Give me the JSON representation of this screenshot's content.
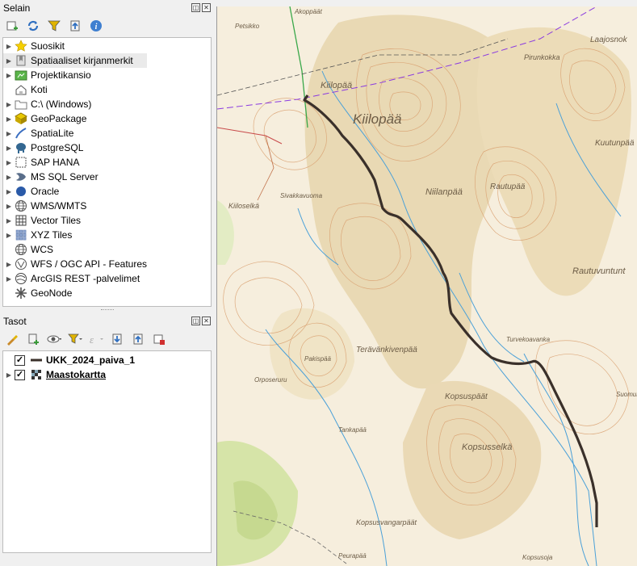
{
  "browser": {
    "title": "Selain",
    "items": [
      {
        "label": "Suosikit",
        "icon": "star-icon"
      },
      {
        "label": "Spatiaaliset kirjanmerkit",
        "icon": "bookmark-icon"
      },
      {
        "label": "Projektikansio",
        "icon": "project-folder-icon"
      },
      {
        "label": "Koti",
        "icon": "home-icon"
      },
      {
        "label": "C:\\ (Windows)",
        "icon": "drive-icon"
      },
      {
        "label": "GeoPackage",
        "icon": "geopackage-icon"
      },
      {
        "label": "SpatiaLite",
        "icon": "spatialite-icon"
      },
      {
        "label": "PostgreSQL",
        "icon": "postgresql-icon"
      },
      {
        "label": "SAP HANA",
        "icon": "hana-icon"
      },
      {
        "label": "MS SQL Server",
        "icon": "mssql-icon"
      },
      {
        "label": "Oracle",
        "icon": "oracle-icon"
      },
      {
        "label": "WMS/WMTS",
        "icon": "globe-icon"
      },
      {
        "label": "Vector Tiles",
        "icon": "vector-tiles-icon"
      },
      {
        "label": "XYZ Tiles",
        "icon": "xyz-tiles-icon"
      },
      {
        "label": "WCS",
        "icon": "globe-icon"
      },
      {
        "label": "WFS / OGC API - Features",
        "icon": "wfs-icon"
      },
      {
        "label": "ArcGIS REST -palvelimet",
        "icon": "arcgis-icon"
      },
      {
        "label": "GeoNode",
        "icon": "geonode-icon"
      }
    ]
  },
  "layers": {
    "title": "Tasot",
    "items": [
      {
        "label": "UKK_2024_paiva_1",
        "checked": true,
        "icon": "line-layer-icon"
      },
      {
        "label": "Maastokartta",
        "checked": true,
        "icon": "raster-layer-icon"
      }
    ]
  },
  "map": {
    "place_labels": [
      "Kiilopää",
      "Kiilopää",
      "Niilanpää",
      "Rautupää",
      "Rautuvuntunt",
      "Kuutunpää",
      "Laajosnok",
      "Pirunkokka",
      "Kiiloselkä",
      "Sivakkavuoma",
      "Pakispää",
      "Orposeruru",
      "Terävänkivenpää",
      "Kopsuspäät",
      "Kopsusselkä",
      "Tankapää",
      "Kopsusvangarpäät",
      "Turvekoavanka",
      "Akoppäät",
      "Petsikko",
      "Suomukk",
      "Peurapää",
      "Kopsusoja"
    ],
    "route_color": "#3a302a"
  }
}
